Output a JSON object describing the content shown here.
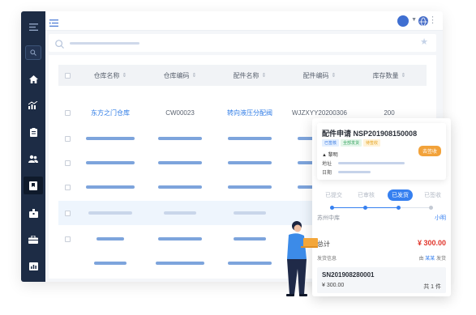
{
  "table": {
    "headers": [
      "仓库名称",
      "仓库编码",
      "配件名称",
      "配件编码",
      "库存数量"
    ],
    "first_row": {
      "warehouse_name": "东方之门仓库",
      "warehouse_code": "CW00023",
      "part_name": "转向液压分配阀",
      "part_code": "WJZXYY20200306",
      "stock_qty": "200"
    }
  },
  "order_panel": {
    "title": "配件申请 NSP201908150008",
    "tags": [
      "已签核",
      "全部发货",
      "待签收"
    ],
    "action_button": "去签收",
    "user": "黎明",
    "address_label": "地址",
    "date_label": "日期",
    "steps": [
      "已提交",
      "已审核",
      "已发货",
      "已签收"
    ],
    "active_step": 2,
    "route_from": "苏州中库",
    "route_to": "小明",
    "total_label": "总计",
    "total_amount": "¥ 300.00",
    "ship_info_label": "发货信息",
    "ship_info_prefix": "由",
    "ship_info_who": "某某",
    "ship_info_suffix": "发货",
    "shipment": {
      "number": "SN201908280001",
      "amount": "¥ 300.00",
      "qty": "共 1 件"
    }
  },
  "colors": {
    "sidebar": "#1d2c45",
    "accent": "#3680f0",
    "link": "#2e7be6",
    "orange": "#f2a23a",
    "price_red": "#e0352b"
  }
}
